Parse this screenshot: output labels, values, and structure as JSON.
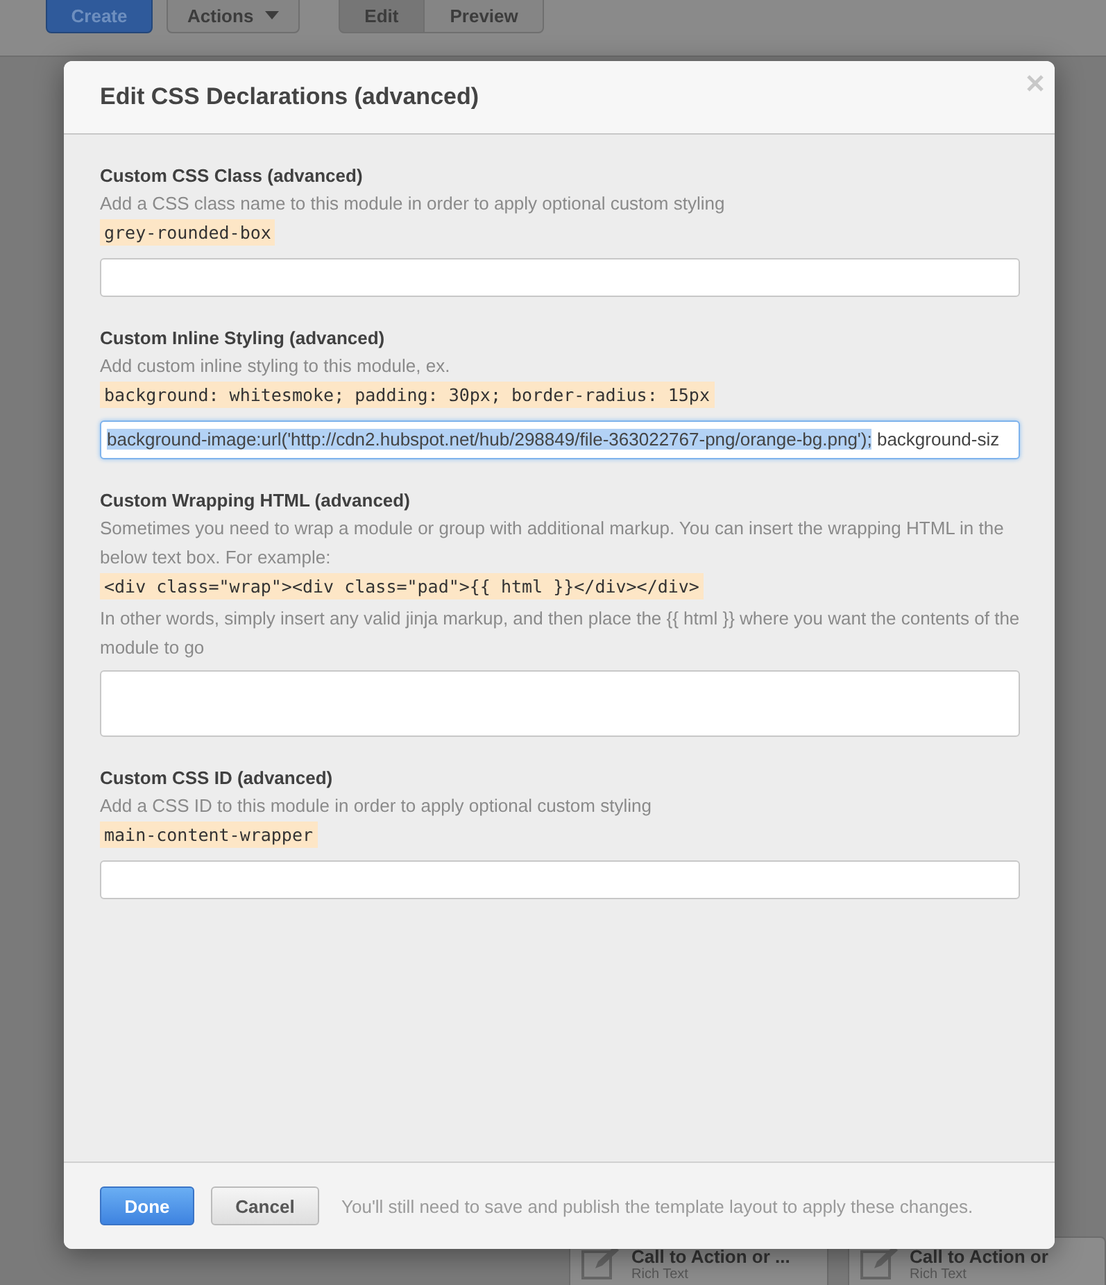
{
  "toolbar": {
    "create": "Create",
    "actions": "Actions",
    "tabs": [
      {
        "label": "Edit",
        "selected": true
      },
      {
        "label": "Preview",
        "selected": false
      }
    ]
  },
  "background_modules": [
    {
      "title": "Call to Action or ...",
      "subtitle": "Rich Text"
    },
    {
      "title": "Call to Action or",
      "subtitle": "Rich Text"
    }
  ],
  "dialog": {
    "title": "Edit CSS Declarations (advanced)",
    "sections": [
      {
        "label": "Custom CSS Class (advanced)",
        "help": [
          "Add a CSS class name to this module in order to apply optional custom styling"
        ],
        "example": "grey-rounded-box",
        "field": {
          "kind": "input",
          "focused": false
        }
      },
      {
        "label": "Custom Inline Styling (advanced)",
        "help": [
          "Add custom inline styling to this module, ex."
        ],
        "example": "background: whitesmoke; padding: 30px; border-radius: 15px",
        "field": {
          "kind": "input",
          "selected_text": "background-image:url('http://cdn2.hubspot.net/hub/298849/file-363022767-png/orange-bg.png');",
          "value": " background-siz",
          "focused": true
        }
      },
      {
        "label": "Custom Wrapping HTML (advanced)",
        "help": [
          "Sometimes you need to wrap a module or group with additional markup. You can insert the wrapping HTML in the below text box. For example:",
          "In other words, simply insert any valid jinja markup, and then place the {{ html }} where you want the contents of the module to go"
        ],
        "example": "<div class=\"wrap\"><div class=\"pad\">{{ html }}</div></div>",
        "field": {
          "kind": "textarea",
          "focused": false
        }
      },
      {
        "label": "Custom CSS ID (advanced)",
        "help": [
          "Add a CSS ID to this module in order to apply optional custom styling"
        ],
        "example": "main-content-wrapper",
        "field": {
          "kind": "input",
          "focused": false
        }
      }
    ],
    "done": "Done",
    "cancel": "Cancel",
    "note": "You'll still need to save and publish the template layout to apply these changes."
  }
}
